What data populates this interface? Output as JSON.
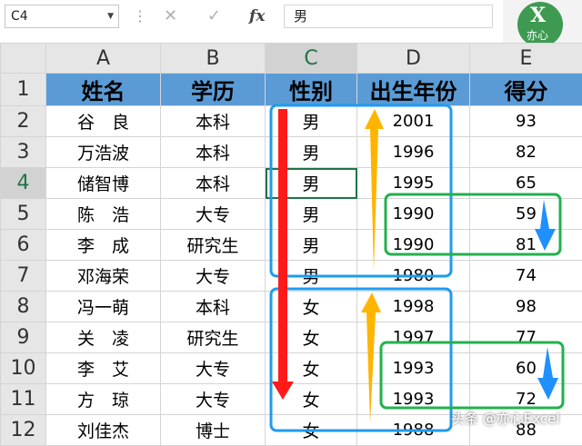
{
  "formula_bar": {
    "name_box": "C4",
    "formula_value": "男",
    "fx_label": "fx"
  },
  "logo": {
    "letter": "X",
    "text": "亦心"
  },
  "columns": [
    "A",
    "B",
    "C",
    "D",
    "E"
  ],
  "rows": [
    "1",
    "2",
    "3",
    "4",
    "5",
    "6",
    "7",
    "8",
    "9",
    "10",
    "11",
    "12"
  ],
  "header": [
    "姓名",
    "学历",
    "性别",
    "出生年份",
    "得分"
  ],
  "data": [
    [
      "谷　良",
      "本科",
      "男",
      "2001",
      "93"
    ],
    [
      "万浩波",
      "本科",
      "男",
      "1996",
      "82"
    ],
    [
      "储智博",
      "本科",
      "男",
      "1995",
      "65"
    ],
    [
      "陈　浩",
      "大专",
      "男",
      "1990",
      "59"
    ],
    [
      "李　成",
      "研究生",
      "男",
      "1990",
      "81"
    ],
    [
      "邓海荣",
      "大专",
      "男",
      "1980",
      "74"
    ],
    [
      "冯一萌",
      "本科",
      "女",
      "1998",
      "98"
    ],
    [
      "关　凌",
      "研究生",
      "女",
      "1997",
      "77"
    ],
    [
      "李　艾",
      "大专",
      "女",
      "1993",
      "60"
    ],
    [
      "方　琼",
      "大专",
      "女",
      "1993",
      "72"
    ],
    [
      "刘佳杰",
      "博士",
      "女",
      "1988",
      "88"
    ]
  ],
  "colors": {
    "header_fill": "#5b9bd5",
    "blue_box": "#1e9bf0",
    "green_box": "#22b14c",
    "red_arrow": "#ff1a1a",
    "orange_arrow": "#ffb400",
    "blue_arrow": "#1e90ff"
  },
  "watermark": "头条 @亦心Excel"
}
